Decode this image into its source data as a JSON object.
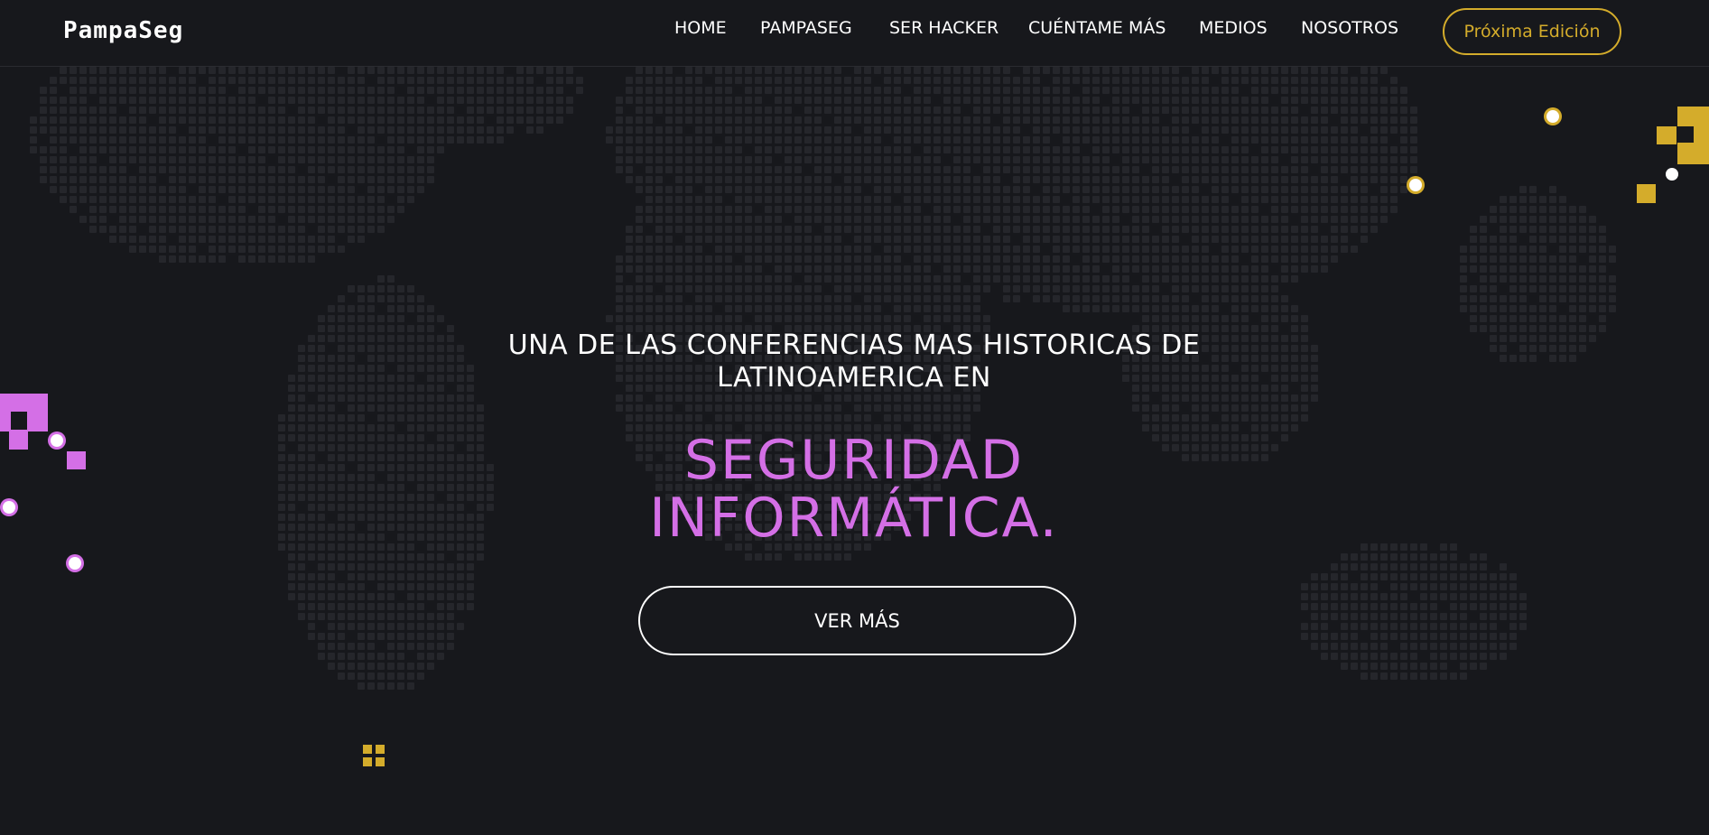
{
  "header": {
    "logo": "PampaSeg",
    "nav": [
      {
        "label": "HOME"
      },
      {
        "label": "PAMPASEG"
      },
      {
        "label": "SER HACKER"
      },
      {
        "label": "CUÉNTAME MÁS"
      },
      {
        "label": "MEDIOS"
      },
      {
        "label": "NOSOTROS"
      }
    ],
    "cta_label": "Próxima Edición"
  },
  "hero": {
    "subtitle_line1": "UNA DE LAS CONFERENCIAS MAS HISTORICAS DE",
    "subtitle_line2": "LATINOAMERICA EN",
    "headline_line1": "SEGURIDAD",
    "headline_line2": "INFORMÁTICA.",
    "button_label": "VER MÁS"
  },
  "colors": {
    "background": "#17181c",
    "accent_gold": "#d4ac2b",
    "accent_pink": "#d46fe6",
    "map_dot": "#25262b"
  }
}
